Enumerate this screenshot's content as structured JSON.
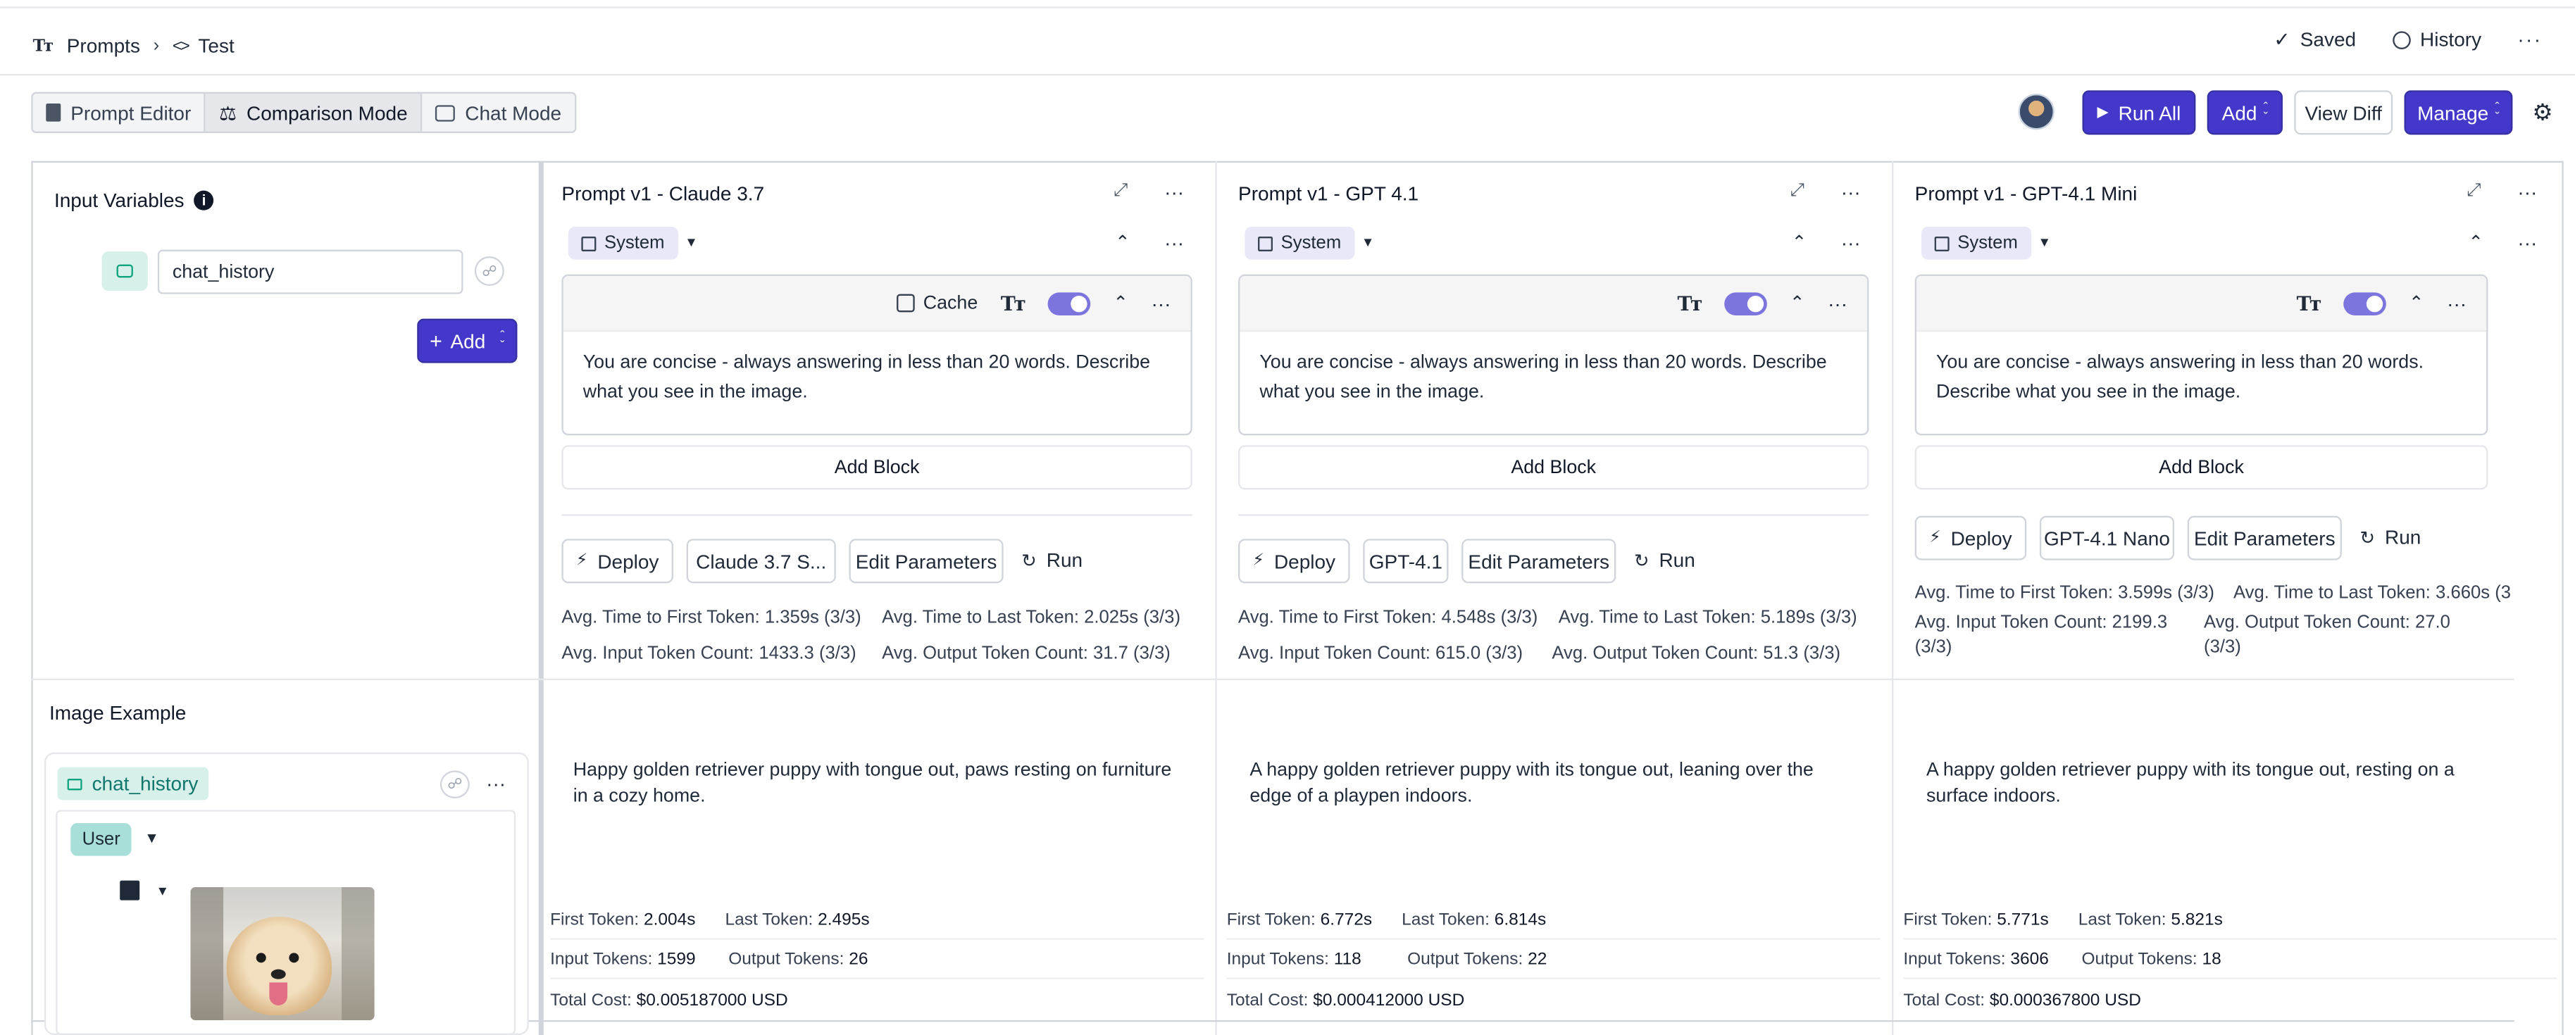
{
  "breadcrumb": {
    "root": "Prompts",
    "current": "Test"
  },
  "topbar": {
    "saved": "Saved",
    "history": "History"
  },
  "modes": [
    "Prompt Editor",
    "Comparison Mode",
    "Chat Mode"
  ],
  "actions": {
    "run_all": "Run All",
    "add": "Add",
    "view_diff": "View Diff",
    "manage": "Manage"
  },
  "sidebar": {
    "title": "Input Variables",
    "variable": "chat_history",
    "add": "Add",
    "image_title": "Image Example",
    "chat_var": "chat_history",
    "role": "User"
  },
  "columns": [
    {
      "title": "Prompt v1 - Claude 3.7",
      "role": "System",
      "cache": "Cache",
      "text": "You are concise - always answering in less than 20 words. Describe what you see in the image.",
      "add_block": "Add Block",
      "deploy": "Deploy",
      "model": "Claude 3.7 S...",
      "edit": "Edit Parameters",
      "run": "Run",
      "avg_first": "Avg. Time to First Token: 1.359s (3/3)",
      "avg_last": "Avg. Time to Last Token: 2.025s (3/3)",
      "avg_input": "Avg. Input Token Count: 1433.3 (3/3)",
      "avg_output": "Avg. Output Token Count: 31.7 (3/3)",
      "response": "Happy golden retriever puppy with tongue out, paws resting on furniture in a cozy home.",
      "first_token": "First Token:",
      "first_val": "2.004s",
      "last_token": "Last Token:",
      "last_val": "2.495s",
      "input_tokens": "Input Tokens:",
      "input_val": "1599",
      "output_tokens": "Output Tokens:",
      "output_val": "26",
      "cost_label": "Total Cost:",
      "cost_val": "$0.005187000 USD"
    },
    {
      "title": "Prompt v1 - GPT 4.1",
      "role": "System",
      "text": "You are concise - always answering in less than 20 words. Describe what you see in the image.",
      "add_block": "Add Block",
      "deploy": "Deploy",
      "model": "GPT-4.1",
      "edit": "Edit Parameters",
      "run": "Run",
      "avg_first": "Avg. Time to First Token: 4.548s (3/3)",
      "avg_last": "Avg. Time to Last Token: 5.189s (3/3)",
      "avg_input": "Avg. Input Token Count: 615.0 (3/3)",
      "avg_output": "Avg. Output Token Count: 51.3 (3/3)",
      "response": "A happy golden retriever puppy with its tongue out, leaning over the edge of a playpen indoors.",
      "first_token": "First Token:",
      "first_val": "6.772s",
      "last_token": "Last Token:",
      "last_val": "6.814s",
      "input_tokens": "Input Tokens:",
      "input_val": "118",
      "output_tokens": "Output Tokens:",
      "output_val": "22",
      "cost_label": "Total Cost:",
      "cost_val": "$0.000412000 USD"
    },
    {
      "title": "Prompt v1 - GPT-4.1 Mini",
      "role": "System",
      "text": "You are concise - always answering in less than 20 words. Describe what you see in the image.",
      "add_block": "Add Block",
      "deploy": "Deploy",
      "model": "GPT-4.1 Nano",
      "edit": "Edit Parameters",
      "run": "Run",
      "avg_first": "Avg. Time to First Token: 3.599s (3/3)",
      "avg_last": "Avg. Time to Last Token: 3.660s (3",
      "avg_input": "Avg. Input Token Count: 2199.3 (3/3)",
      "avg_output": "Avg. Output Token Count: 27.0 (3/3)",
      "response": "A happy golden retriever puppy with its tongue out, resting on a surface indoors.",
      "first_token": "First Token:",
      "first_val": "5.771s",
      "last_token": "Last Token:",
      "last_val": "5.821s",
      "input_tokens": "Input Tokens:",
      "input_val": "3606",
      "output_tokens": "Output Tokens:",
      "output_val": "18",
      "cost_label": "Total Cost:",
      "cost_val": "$0.000367800 USD"
    }
  ],
  "colors": {
    "primary": "#4338ca",
    "toggle": "#7c75dd",
    "variable_chip": "#d7f0ea"
  }
}
